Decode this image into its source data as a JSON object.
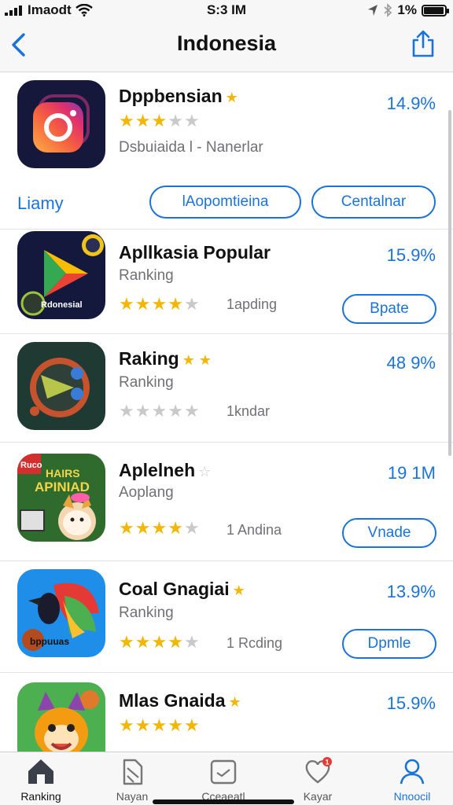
{
  "status": {
    "carrier": "Imaodt",
    "time": "S:3 IM",
    "battery": "1%",
    "battery_level": 0.9
  },
  "nav": {
    "title": "Indonesia"
  },
  "featured": {
    "name": "Dppbensian",
    "stars": 3,
    "subtitle": "Dsbuiaida l - Nanerlar",
    "percent": "14.9%"
  },
  "filter": {
    "label": "Liamy",
    "button1": "lAopomtieina",
    "button2": "Centalnar"
  },
  "apps": [
    {
      "name": "Apllkasia Popular",
      "sub": "Ranking",
      "stars": 4,
      "count": "1apding",
      "percent": "15.9%",
      "button": "Bpate",
      "icon_text": "Rdonesial"
    },
    {
      "name": "Raking",
      "sub": "Ranking",
      "stars": 0,
      "count": "1kndar",
      "percent": "48 9%",
      "button": ""
    },
    {
      "name": "Aplelneh",
      "sub": "Aoplang",
      "stars": 4,
      "count": "1 Andina",
      "percent": "19 1M",
      "button": "Vnade",
      "icon_text1": "Ruco",
      "icon_text2": "HAIRS",
      "icon_text3": "APINIAD"
    },
    {
      "name": "Coal Gnagiai",
      "sub": "Ranking",
      "stars": 4,
      "count": "1 Rcding",
      "percent": "13.9%",
      "button": "Dpmle",
      "icon_text": "bppuuas"
    },
    {
      "name": "Mlas Gnaida",
      "sub": "",
      "stars": 5,
      "count": "",
      "percent": "15.9%",
      "button": ""
    }
  ],
  "tabs": [
    {
      "label": "Ranking"
    },
    {
      "label": "Nayan"
    },
    {
      "label": "Cceaeatl"
    },
    {
      "label": "Kayar",
      "badge": "1"
    },
    {
      "label": "Nnoocil"
    }
  ],
  "colors": {
    "accent": "#1a73d9",
    "star": "#f2b705"
  }
}
